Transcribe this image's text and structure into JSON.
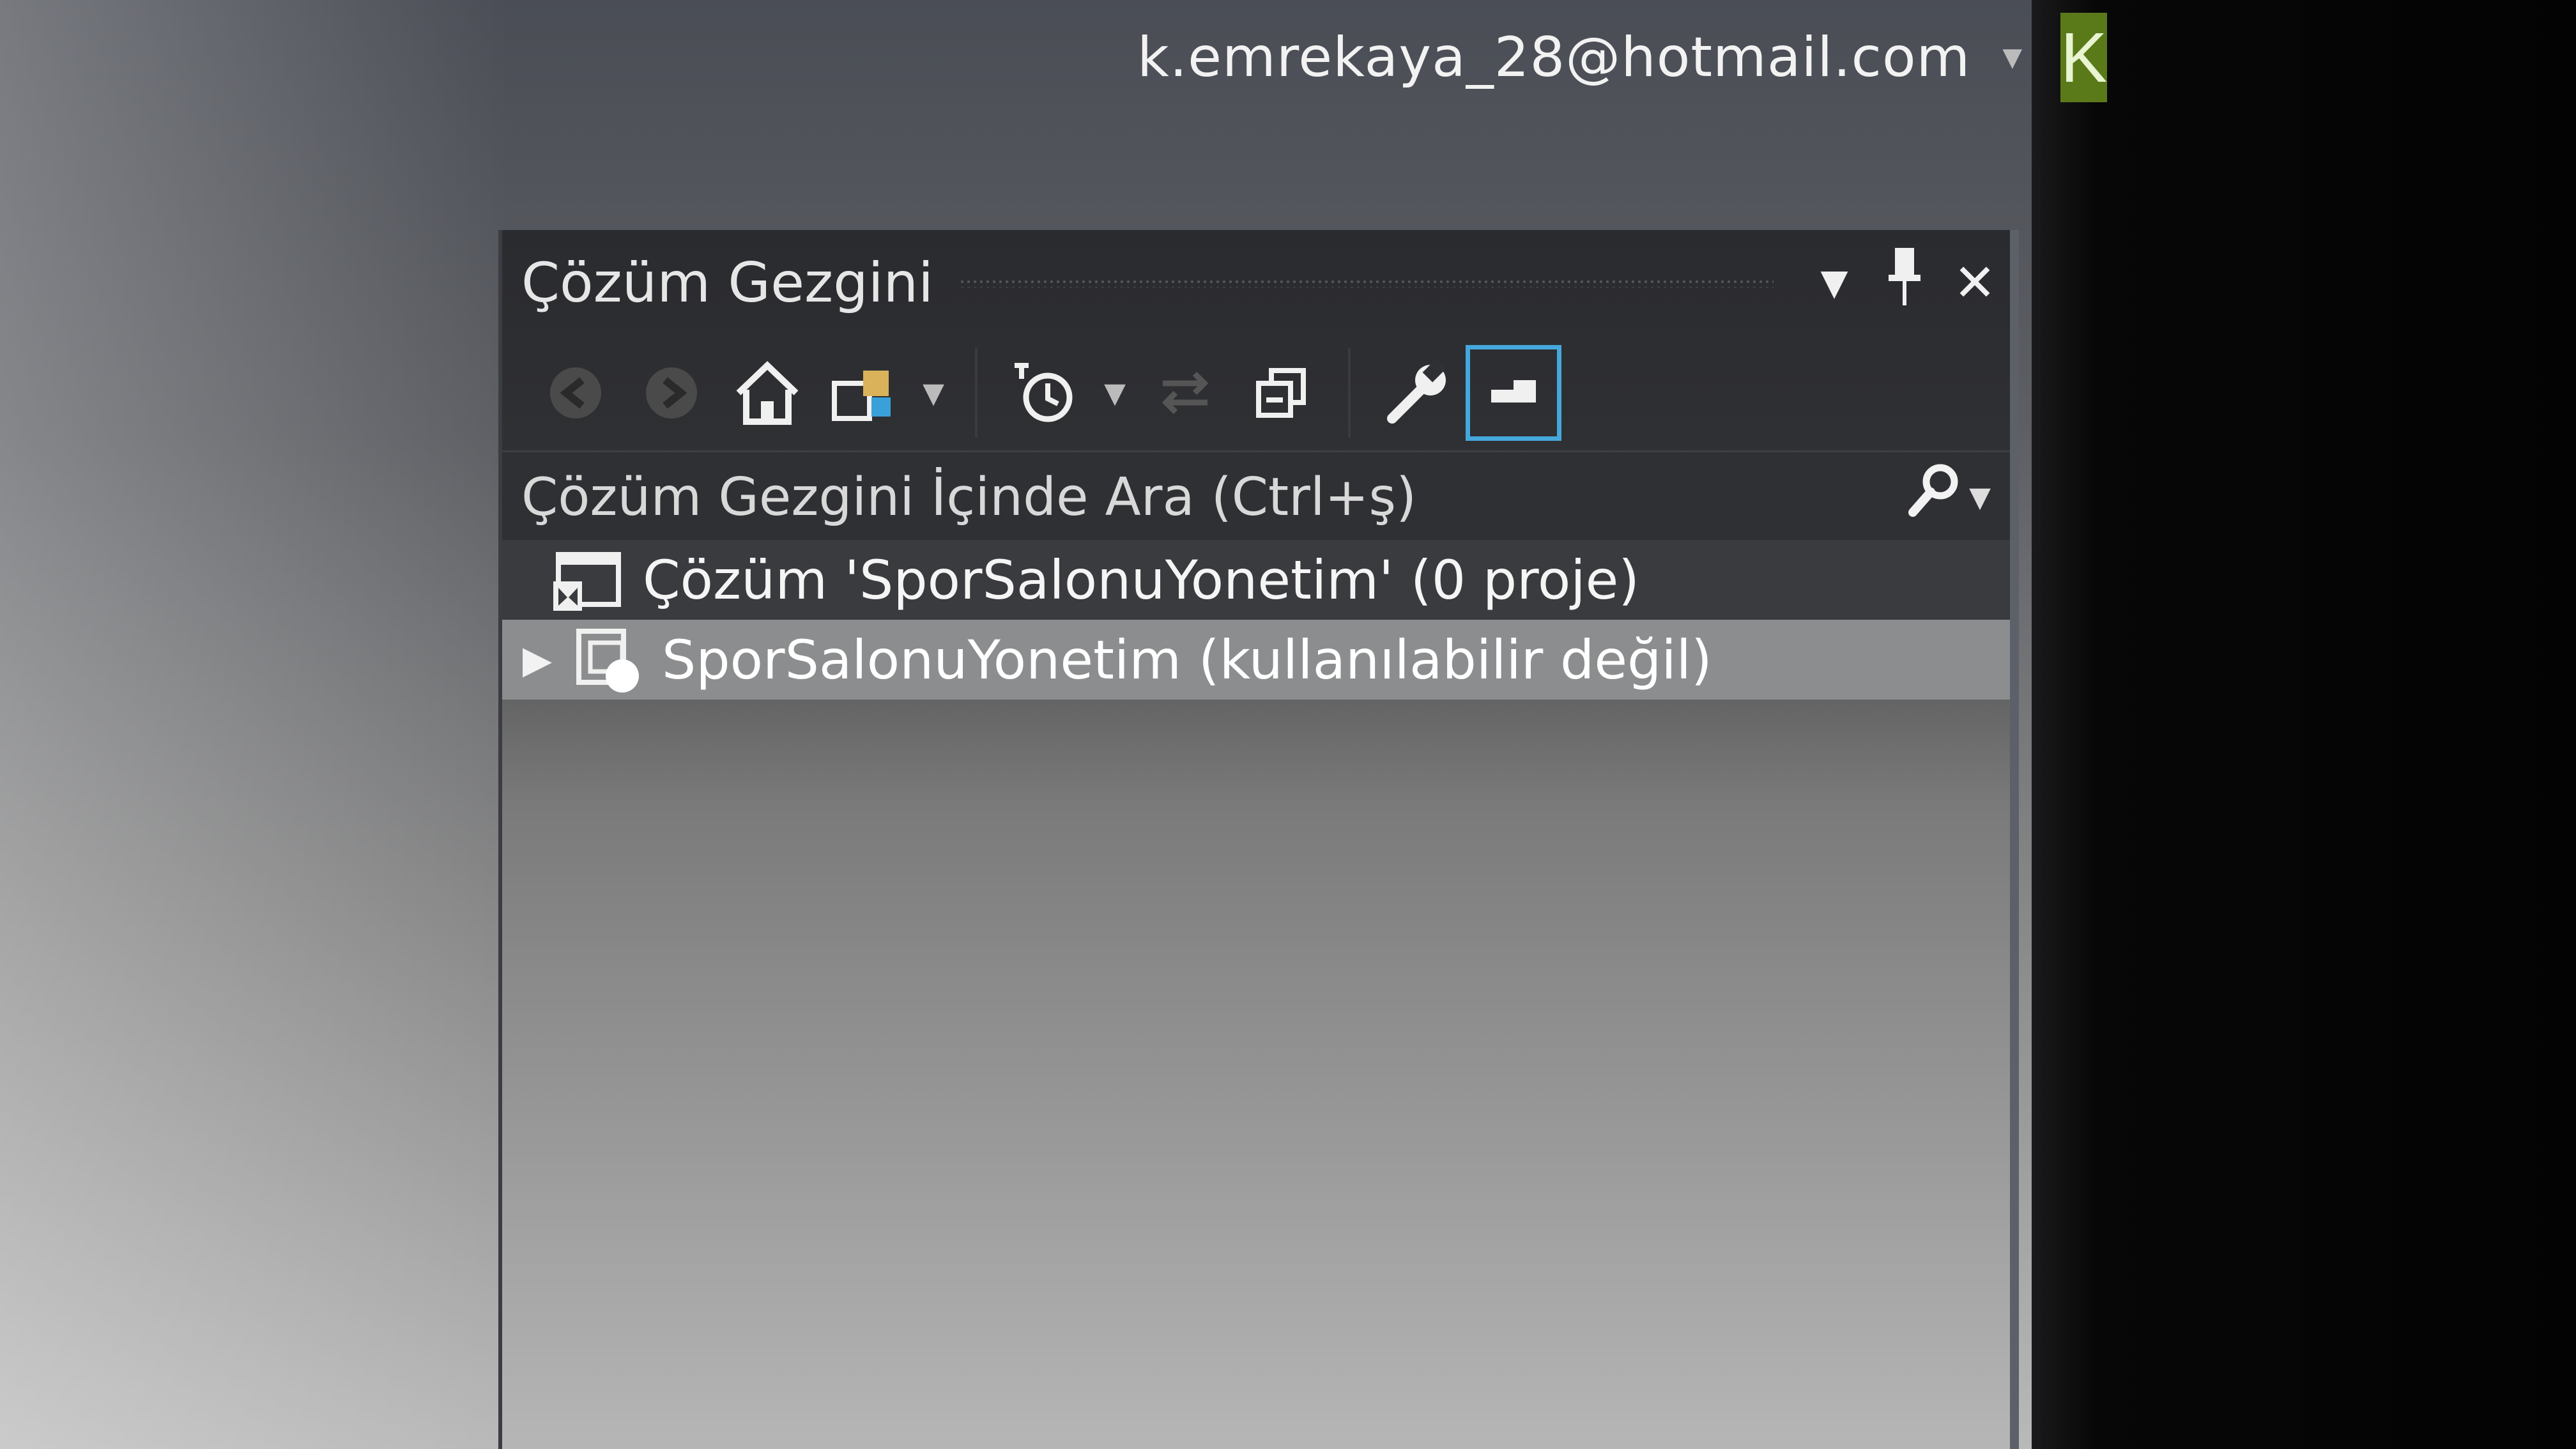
{
  "account": {
    "email": "k.emrekaya_28@hotmail.com",
    "avatar_letter": "K",
    "avatar_color": "#5a7a1a"
  },
  "panel": {
    "title": "Çözüm Gezgini",
    "title_buttons": {
      "dropdown_icon": "chevron-down-icon",
      "pin_icon": "pin-icon",
      "close_icon": "close-icon"
    },
    "toolbar": [
      {
        "name": "back",
        "icon": "back-arrow-icon"
      },
      {
        "name": "forward",
        "icon": "forward-arrow-icon"
      },
      {
        "name": "home",
        "icon": "home-icon"
      },
      {
        "name": "switch-views",
        "icon": "switch-views-icon"
      },
      {
        "name": "pending-changes-filter",
        "icon": "clock-filter-icon"
      },
      {
        "name": "sync",
        "icon": "sync-icon"
      },
      {
        "name": "collapse-all",
        "icon": "collapse-all-icon"
      },
      {
        "name": "properties",
        "icon": "wrench-icon"
      },
      {
        "name": "preview",
        "icon": "preview-icon",
        "active": true
      }
    ],
    "search": {
      "placeholder": "Çözüm Gezgini İçinde Ara (Ctrl+ş)"
    },
    "tree": {
      "solution_label": "Çözüm 'SporSalonuYonetim' (0 proje)",
      "project_label": "SporSalonuYonetim (kullanılabilir değil)"
    }
  },
  "colors": {
    "accent_active": "#45a8dc",
    "panel_background": "#2f3033",
    "selected_row": "#8c8d8e"
  }
}
